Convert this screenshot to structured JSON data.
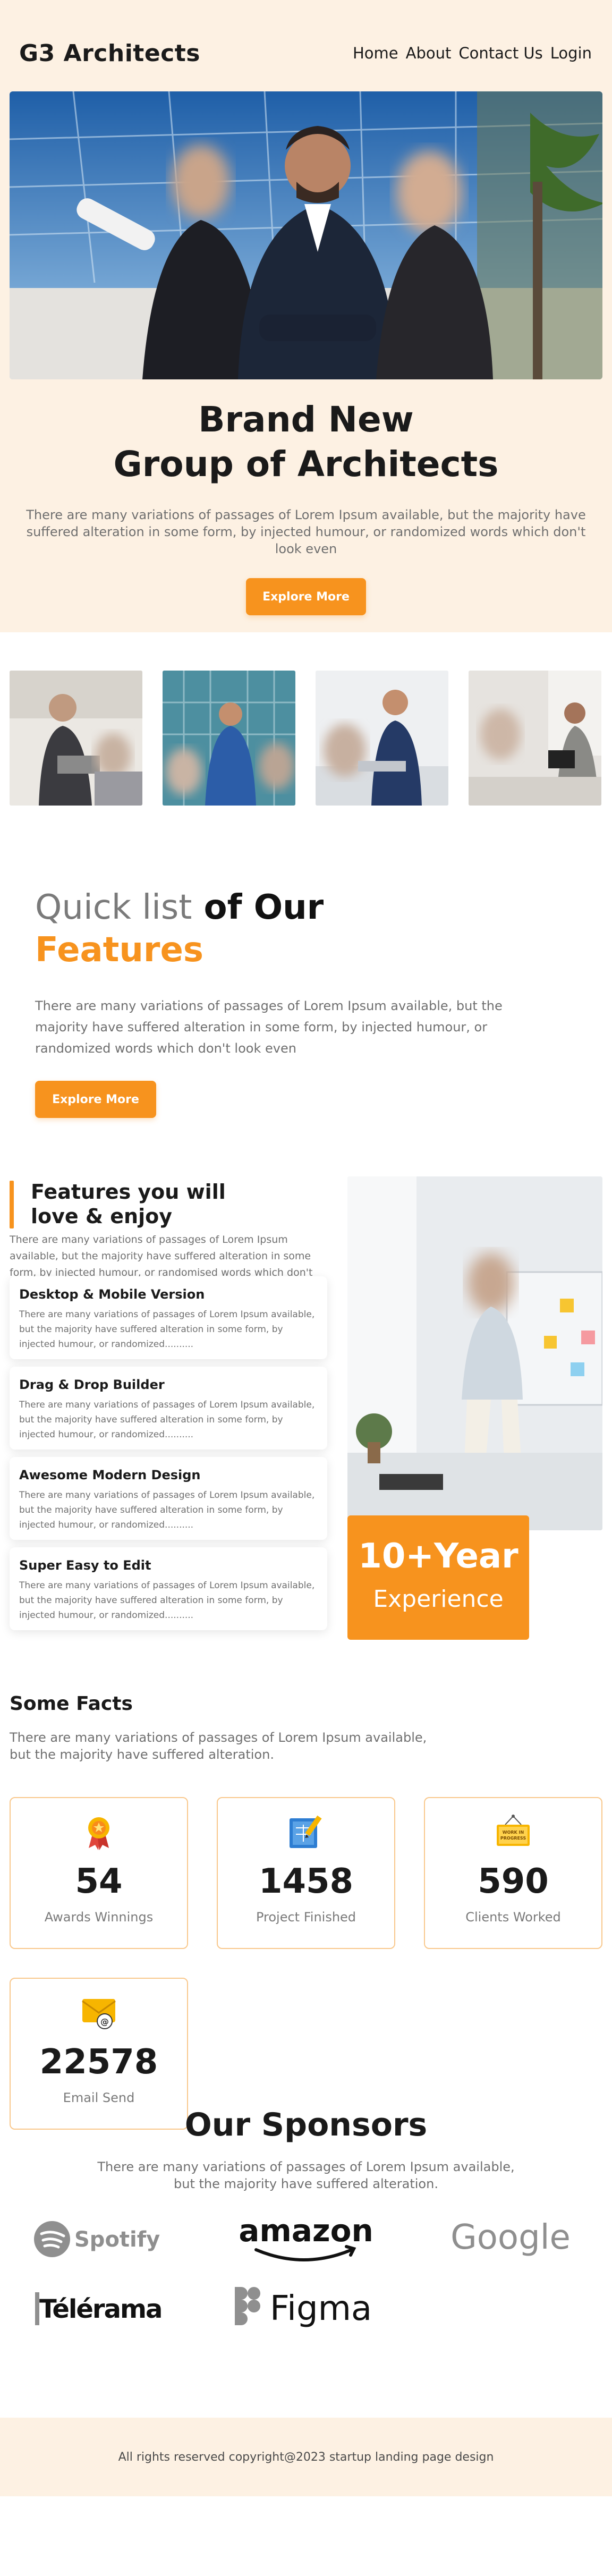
{
  "header": {
    "logo": "G3 Architects",
    "nav": [
      "Home",
      "About",
      "Contact Us",
      "Login"
    ]
  },
  "hero": {
    "title_line1": "Brand New",
    "title_line2": "Group of Architects",
    "description": "There are many variations of passages of Lorem Ipsum available, but the majority have suffered alteration in some form, by injected humour, or randomized words which don't look even",
    "button": "Explore More"
  },
  "quick_list": {
    "title_light": "Quick list",
    "title_bold": " of Our",
    "title_orange": "Features",
    "description": "There are many variations of passages of Lorem Ipsum available, but the majority have suffered alteration in some form, by injected humour, or randomized words which don't look even",
    "button": "Explore More"
  },
  "features": {
    "title_line1": "Features you will",
    "title_line2": "love & enjoy",
    "description": "There are many variations of passages of Lorem Ipsum available, but the majority have suffered alteration in some form, by injected humour, or randomised words which don't look even",
    "items": [
      {
        "title": "Desktop & Mobile Version",
        "text": "There are many variations of passages of Lorem Ipsum available, but the majority have suffered alteration in some form, by injected humour, or randomized.........."
      },
      {
        "title": "Drag & Drop Builder",
        "text": "There are many variations of passages of Lorem Ipsum available, but the majority have suffered alteration in some form, by injected humour, or randomized.........."
      },
      {
        "title": "Awesome Modern Design",
        "text": "There are many variations of passages of Lorem Ipsum available, but the majority have suffered alteration in some form, by injected humour, or randomized.........."
      },
      {
        "title": "Super Easy to Edit",
        "text": "There are many variations of passages of Lorem Ipsum available, but the majority have suffered alteration in some form, by injected humour, or randomized.........."
      }
    ],
    "experience_number": "10+Year",
    "experience_label": "Experience"
  },
  "facts": {
    "title": "Some Facts",
    "description": "There are many variations of passages of Lorem Ipsum available, but the majority have suffered alteration.",
    "stats": [
      {
        "icon": "award-medal-icon",
        "number": "54",
        "label": "Awards Winnings"
      },
      {
        "icon": "blueprint-pencil-icon",
        "number": "1458",
        "label": "Project Finished"
      },
      {
        "icon": "work-in-progress-sign-icon",
        "number": "590",
        "label": "Clients Worked"
      },
      {
        "icon": "email-envelope-icon",
        "number": "22578",
        "label": "Email Send"
      }
    ],
    "sign_text_line1": "WORK IN",
    "sign_text_line2": "PROGRESS"
  },
  "sponsors": {
    "title": "Our Sponsors",
    "description": "There are many variations of passages of Lorem Ipsum available, but the majority have suffered alteration.",
    "logos": [
      "Spotify",
      "amazon",
      "Google",
      "Télérama",
      "Figma"
    ]
  },
  "footer": {
    "copyright": "All rights reserved copyright@2023 startup landing page design"
  },
  "colors": {
    "accent": "#f7931e",
    "peach_bg": "#fdf1e3",
    "card_border": "#f9c88c"
  }
}
